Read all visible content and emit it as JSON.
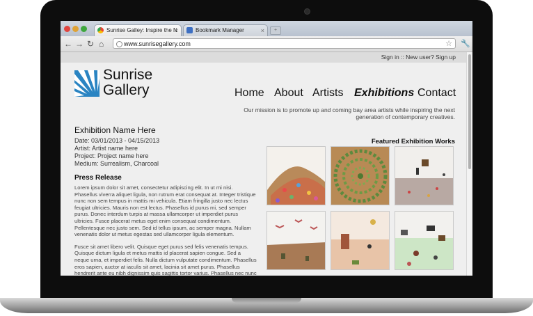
{
  "browser": {
    "tabs": [
      {
        "label": "Sunrise Galley: Inspire the N",
        "close": "×"
      },
      {
        "label": "Bookmark Manager",
        "close": "×"
      }
    ],
    "address": "www.sunrisegallery.com",
    "nav": {
      "back": "←",
      "forward": "→",
      "reload": "↻",
      "home": "⌂"
    },
    "star": "☆",
    "menu": "🔧"
  },
  "site": {
    "auth": {
      "sign_in": "Sign in",
      "separator": " :: New user? ",
      "sign_up": "Sign up"
    },
    "logo": {
      "line1": "Sunrise",
      "line2": "Gallery"
    },
    "nav": [
      {
        "label": "Home"
      },
      {
        "label": "About"
      },
      {
        "label": "Artists"
      },
      {
        "label": "Exhibitions",
        "active": true
      },
      {
        "label": "Contact"
      }
    ],
    "mission_line1": "Our mission is to promote up and coming bay area artists while inspiring the next",
    "mission_line2": "generation of contemporary creatives.",
    "exhibition": {
      "title": "Exhibition Name Here",
      "date": "Date: 03/01/2013 - 04/15/2013",
      "artist": "Artist: Artist name here",
      "project": "Project: Project name here",
      "medium": "Medium: Surrealism, Charcoal"
    },
    "press": {
      "title": "Press Release",
      "p1": "Lorem ipsum dolor sit amet, consectetur adipiscing elit. In ut mi nisi. Phasellus viverra aliquet ligula, non rutrum erat consequat at. Integer tristique nunc non sem tempus in mattis mi vehicula. Etiam fringilla justo nec lectus feugiat ultricies. Mauris non est lectus. Phasellus id purus mi, sed semper purus. Donec interdum turpis at massa ullamcorper ut imperdiet purus ultricies. Fusce placerat metus eget enim consequat condimentum. Pellentesque nec justo sem. Sed id tellus ipsum, ac semper magna. Nullam venenatis dolor ut metus egestas sed ullamcorper ligula elementum.",
      "p2": "Fusce sit amet libero velit. Quisque eget purus sed felis venenatis tempus. Quisque dictum ligula et metus mattis id placerat sapien congue. Sed a neque urna, et imperdiet felis. Nulla dictum vulputate condimentum. Phasellus eros sapien, auctor at iaculis sit amet, lacinia sit amet purus. Phasellus hendrerit ante eu nibh dignissim quis sagittis tortor varius. Phasellus nec nunc nec."
    },
    "featured_title": "Featured Exhibition Works",
    "colors": {
      "logo_blue": "#2a84c2",
      "page_bg": "#efefef",
      "strip_bg": "#dcdcdc"
    }
  }
}
